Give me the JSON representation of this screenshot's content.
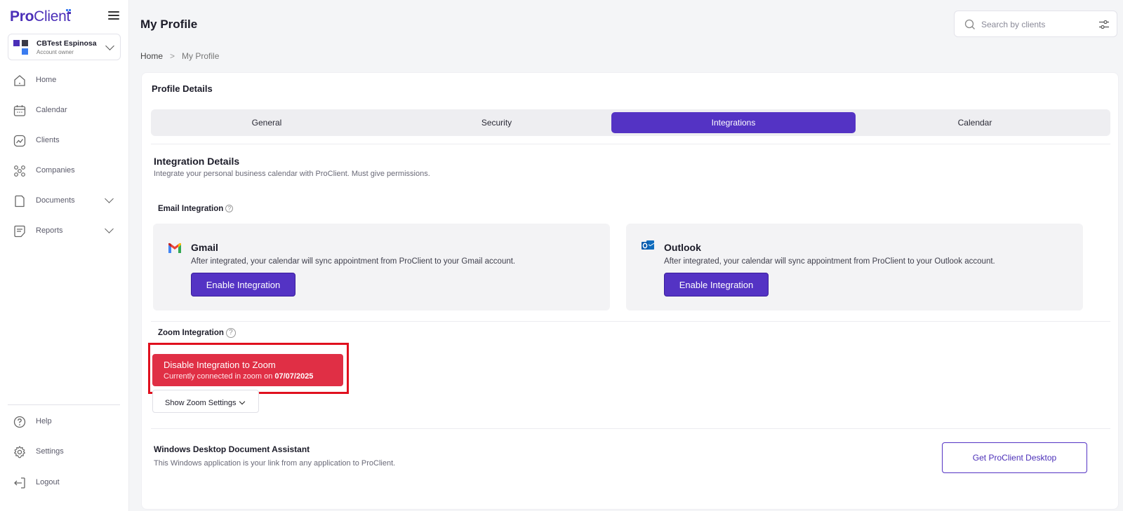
{
  "brand": {
    "logo_pro": "Pro",
    "logo_client": "Client"
  },
  "account": {
    "name": "CBTest Espinosa",
    "role": "Account owner"
  },
  "sidebar": {
    "items": [
      {
        "label": "Home",
        "icon": "home-icon"
      },
      {
        "label": "Calendar",
        "icon": "calendar-icon"
      },
      {
        "label": "Clients",
        "icon": "clients-icon"
      },
      {
        "label": "Companies",
        "icon": "companies-icon"
      },
      {
        "label": "Documents",
        "icon": "documents-icon",
        "expandable": true
      },
      {
        "label": "Reports",
        "icon": "reports-icon",
        "expandable": true
      }
    ],
    "bottom_items": [
      {
        "label": "Help",
        "icon": "help-icon"
      },
      {
        "label": "Settings",
        "icon": "gear-icon"
      },
      {
        "label": "Logout",
        "icon": "logout-icon"
      }
    ]
  },
  "header": {
    "title": "My Profile",
    "search_placeholder": "Search by clients"
  },
  "breadcrumb": {
    "home": "Home",
    "separator": ">",
    "current": "My Profile"
  },
  "profile": {
    "title": "Profile Details",
    "tabs": [
      {
        "label": "General",
        "active": false
      },
      {
        "label": "Security",
        "active": false
      },
      {
        "label": "Integrations",
        "active": true
      },
      {
        "label": "Calendar",
        "active": false
      }
    ]
  },
  "integrations": {
    "title": "Integration Details",
    "description": "Integrate your personal business calendar with ProClient. Must give permissions.",
    "email_label": "Email Integration",
    "gmail": {
      "name": "Gmail",
      "description": "After integrated, your calendar will sync appointment from ProClient to your Gmail account.",
      "button": "Enable Integration"
    },
    "outlook": {
      "name": "Outlook",
      "description": "After integrated, your calendar will sync appointment from ProClient to your Outlook account.",
      "button": "Enable Integration"
    },
    "zoom_label": "Zoom Integration",
    "zoom": {
      "button_main": "Disable Integration to Zoom",
      "button_sub": "Currently connected in zoom on",
      "connected_date": "07/07/2025",
      "settings_button": "Show Zoom Settings"
    },
    "desktop": {
      "title": "Windows Desktop Document Assistant",
      "description": "This Windows application is your link from any application to ProClient.",
      "button": "Get ProClient Desktop"
    }
  },
  "colors": {
    "accent": "#5433c4",
    "danger": "#e02f45",
    "highlight": "#e0101e"
  }
}
